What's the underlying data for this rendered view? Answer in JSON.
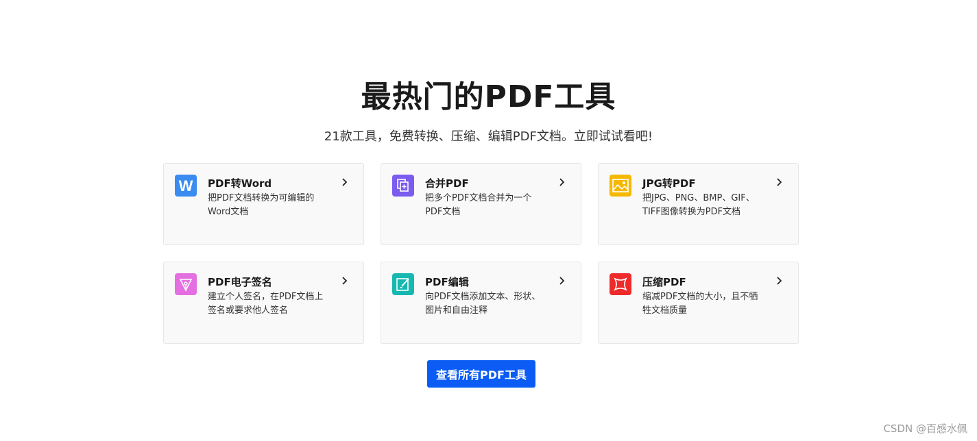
{
  "header": {
    "title": "最热门的PDF工具",
    "subtitle": "21款工具，免费转换、压缩、编辑PDF文档。立即试试看吧!"
  },
  "tools": [
    {
      "title": "PDF转Word",
      "desc": "把PDF文档转换为可编辑的Word文档",
      "icon": "word-icon",
      "color": "#3b8cf0"
    },
    {
      "title": "合并PDF",
      "desc": "把多个PDF文档合并为一个PDF文档",
      "icon": "merge-icon",
      "color": "#7b5cf0"
    },
    {
      "title": "JPG转PDF",
      "desc": "把JPG、PNG、BMP、GIF、TIFF图像转换为PDF文档",
      "icon": "image-icon",
      "color": "#f5b800"
    },
    {
      "title": "PDF电子签名",
      "desc": "建立个人签名，在PDF文档上签名或要求他人签名",
      "icon": "pen-nib-icon",
      "color": "#e46fe0"
    },
    {
      "title": "PDF编辑",
      "desc": "向PDF文档添加文本、形状、图片和自由注释",
      "icon": "edit-icon",
      "color": "#16b8b0"
    },
    {
      "title": "压缩PDF",
      "desc": "缩减PDF文档的大小，且不牺牲文档质量",
      "icon": "compress-icon",
      "color": "#ee2a2a"
    }
  ],
  "cta": {
    "label": "查看所有PDF工具",
    "color": "#0a5cf5"
  },
  "watermark": "CSDN @百感水佩"
}
